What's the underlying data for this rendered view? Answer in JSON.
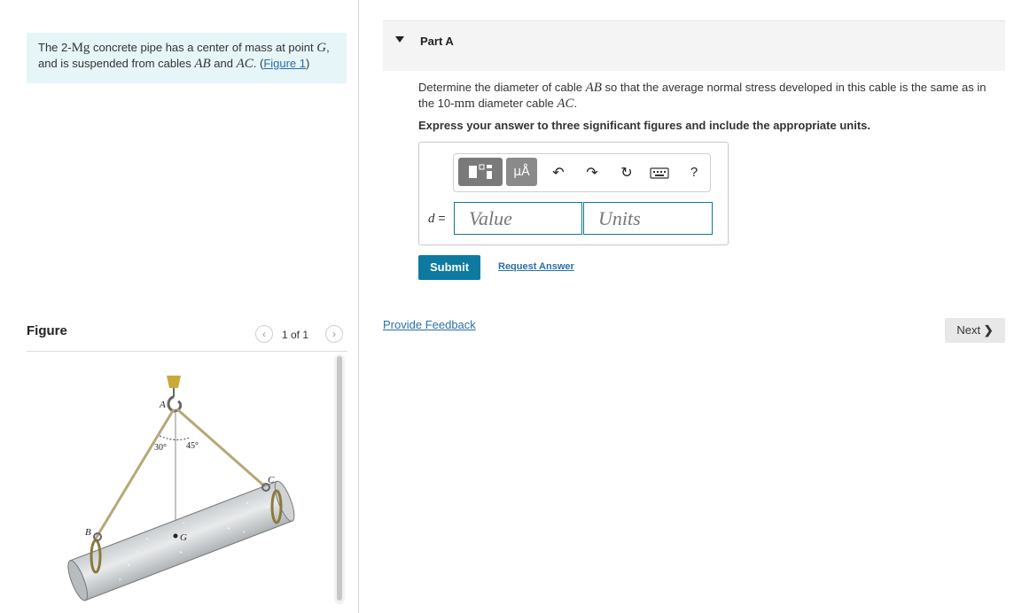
{
  "problem": {
    "text_pre": "The 2-",
    "mass_unit": "Mg",
    "text_mid1": " concrete pipe has a center of mass at point ",
    "point_g": "G",
    "text_mid2": ",",
    "text_line2_pre": "and is suspended from cables ",
    "cable_ab": "AB",
    "text_and": " and ",
    "cable_ac": "AC",
    "text_line2_post": ". (",
    "figure_link": "Figure 1",
    "text_close": ")"
  },
  "figure": {
    "title": "Figure",
    "page_indicator": "1 of 1",
    "labels": {
      "a": "A",
      "b": "B",
      "c": "C",
      "g": "G",
      "angle_left": "30°",
      "angle_right": "45°"
    }
  },
  "part": {
    "title": "Part A",
    "question_pre": "Determine the diameter of cable ",
    "question_cable": "AB",
    "question_mid": " so that the average normal stress developed in this cable is the same as in",
    "question_line2_pre": "the 10-",
    "question_unit": "mm",
    "question_line2_mid": " diameter cable ",
    "question_cable2": "AC",
    "question_line2_post": ".",
    "instruction": "Express your answer to three significant figures and include the appropriate units.",
    "variable": "d",
    "equals": " =",
    "value_placeholder": "Value",
    "units_placeholder": "Units"
  },
  "toolbar": {
    "units_label": "μÅ",
    "icons": [
      "templates-icon",
      "units-icon",
      "undo-icon",
      "redo-icon",
      "reset-icon",
      "keyboard-icon",
      "help-icon"
    ],
    "help_label": "?"
  },
  "actions": {
    "submit": "Submit",
    "request_answer": "Request Answer",
    "provide_feedback": "Provide Feedback",
    "next": "Next"
  },
  "colors": {
    "problem_bg": "#e6f5f7",
    "link": "#2a6fa8",
    "submit_bg": "#0d7aa0",
    "input_border": "#0f7a8c"
  }
}
